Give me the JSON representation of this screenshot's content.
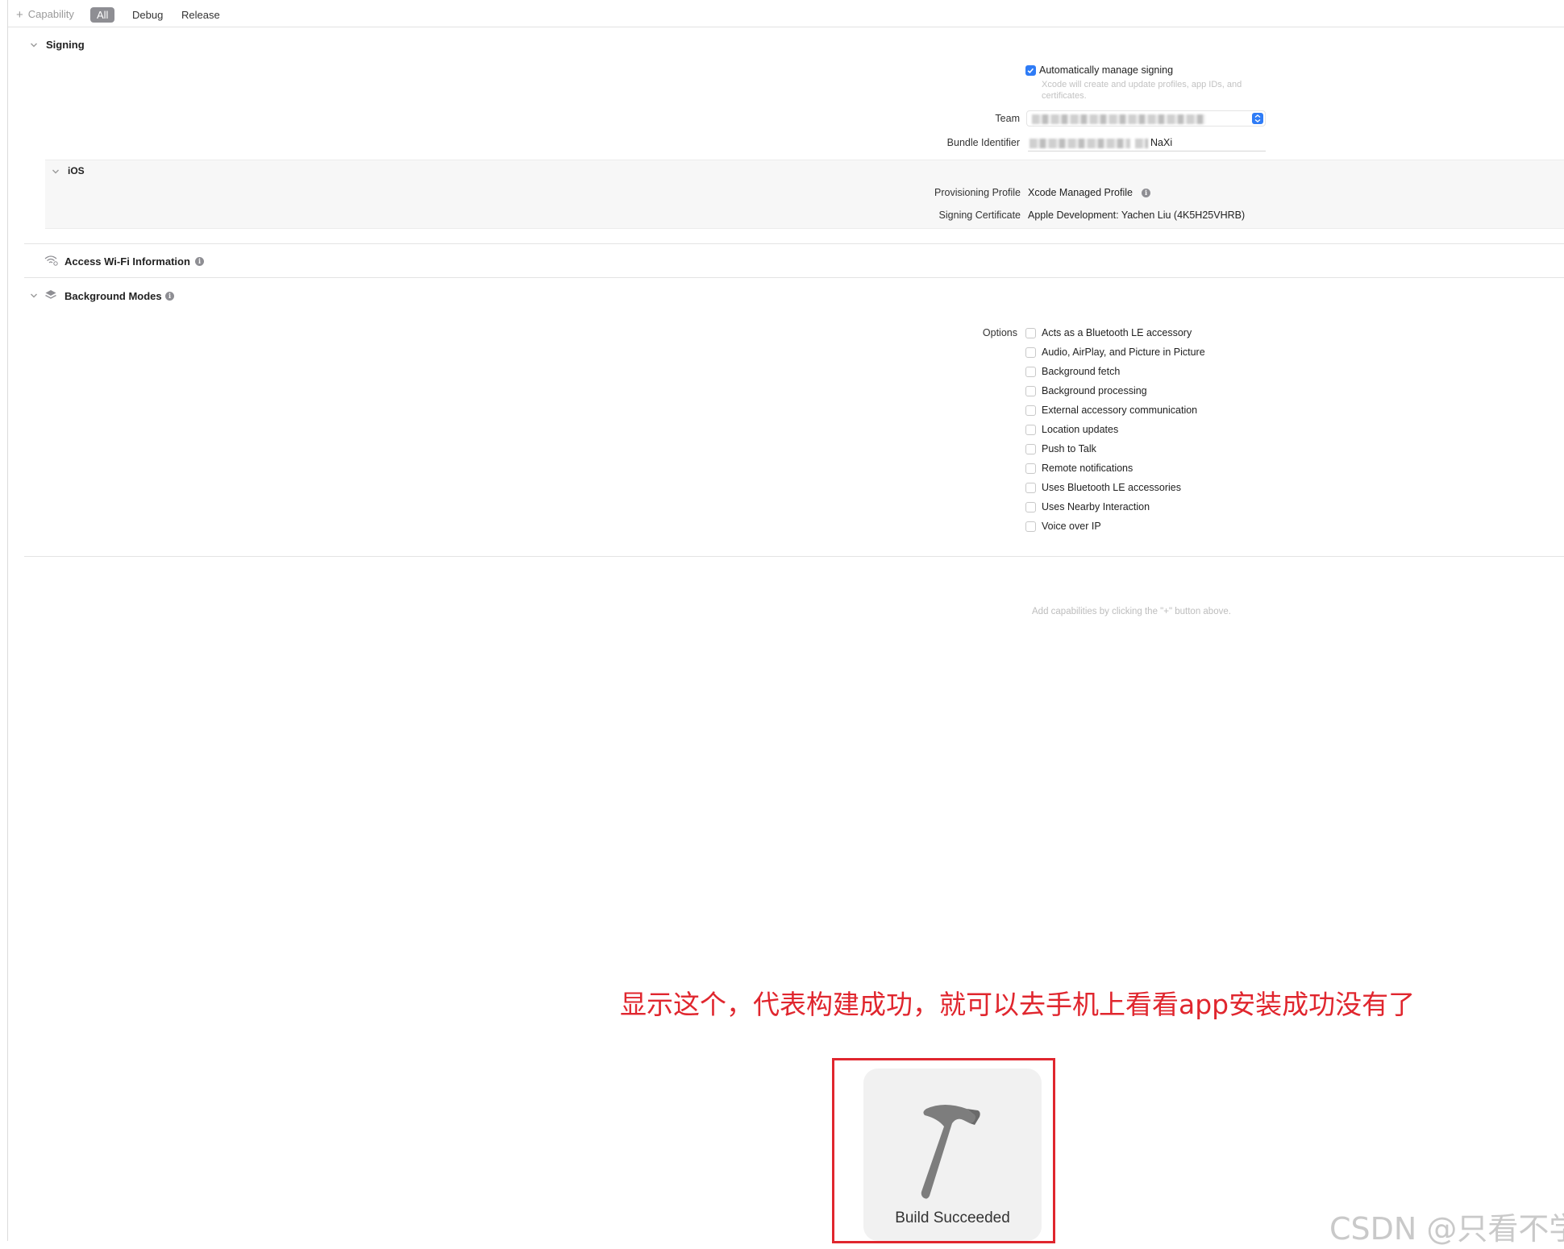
{
  "toolbar": {
    "add_capability_label": "Capability",
    "filters": [
      "All",
      "Debug",
      "Release"
    ],
    "active_filter": "All"
  },
  "signing": {
    "title": "Signing",
    "auto_manage_label": "Automatically manage signing",
    "auto_manage_checked": true,
    "auto_manage_hint": "Xcode will create and update profiles, app IDs, and certificates.",
    "team_label": "Team",
    "bundle_identifier_label": "Bundle Identifier",
    "bundle_identifier_suffix": "NaXi",
    "ios": {
      "title": "iOS",
      "provisioning_profile_label": "Provisioning Profile",
      "provisioning_profile_value": "Xcode Managed Profile",
      "signing_certificate_label": "Signing Certificate",
      "signing_certificate_value": "Apple Development: Yachen Liu (4K5H25VHRB)"
    }
  },
  "wifi": {
    "title": "Access Wi-Fi Information"
  },
  "background_modes": {
    "title": "Background Modes",
    "options_label": "Options",
    "options": [
      "Acts as a Bluetooth LE accessory",
      "Audio, AirPlay, and Picture in Picture",
      "Background fetch",
      "Background processing",
      "External accessory communication",
      "Location updates",
      "Push to Talk",
      "Remote notifications",
      "Uses Bluetooth LE accessories",
      "Uses Nearby Interaction",
      "Voice over IP"
    ]
  },
  "empty_hint": "Add capabilities by clicking the \"+\" button above.",
  "annotation": "显示这个，代表构建成功，就可以去手机上看看app安装成功没有了",
  "hud": {
    "label": "Build Succeeded",
    "icon": "hammer-icon"
  },
  "watermark": "CSDN @只看不学",
  "colors": {
    "accent": "#2f7cf6",
    "annotation_red": "#e0262e"
  }
}
